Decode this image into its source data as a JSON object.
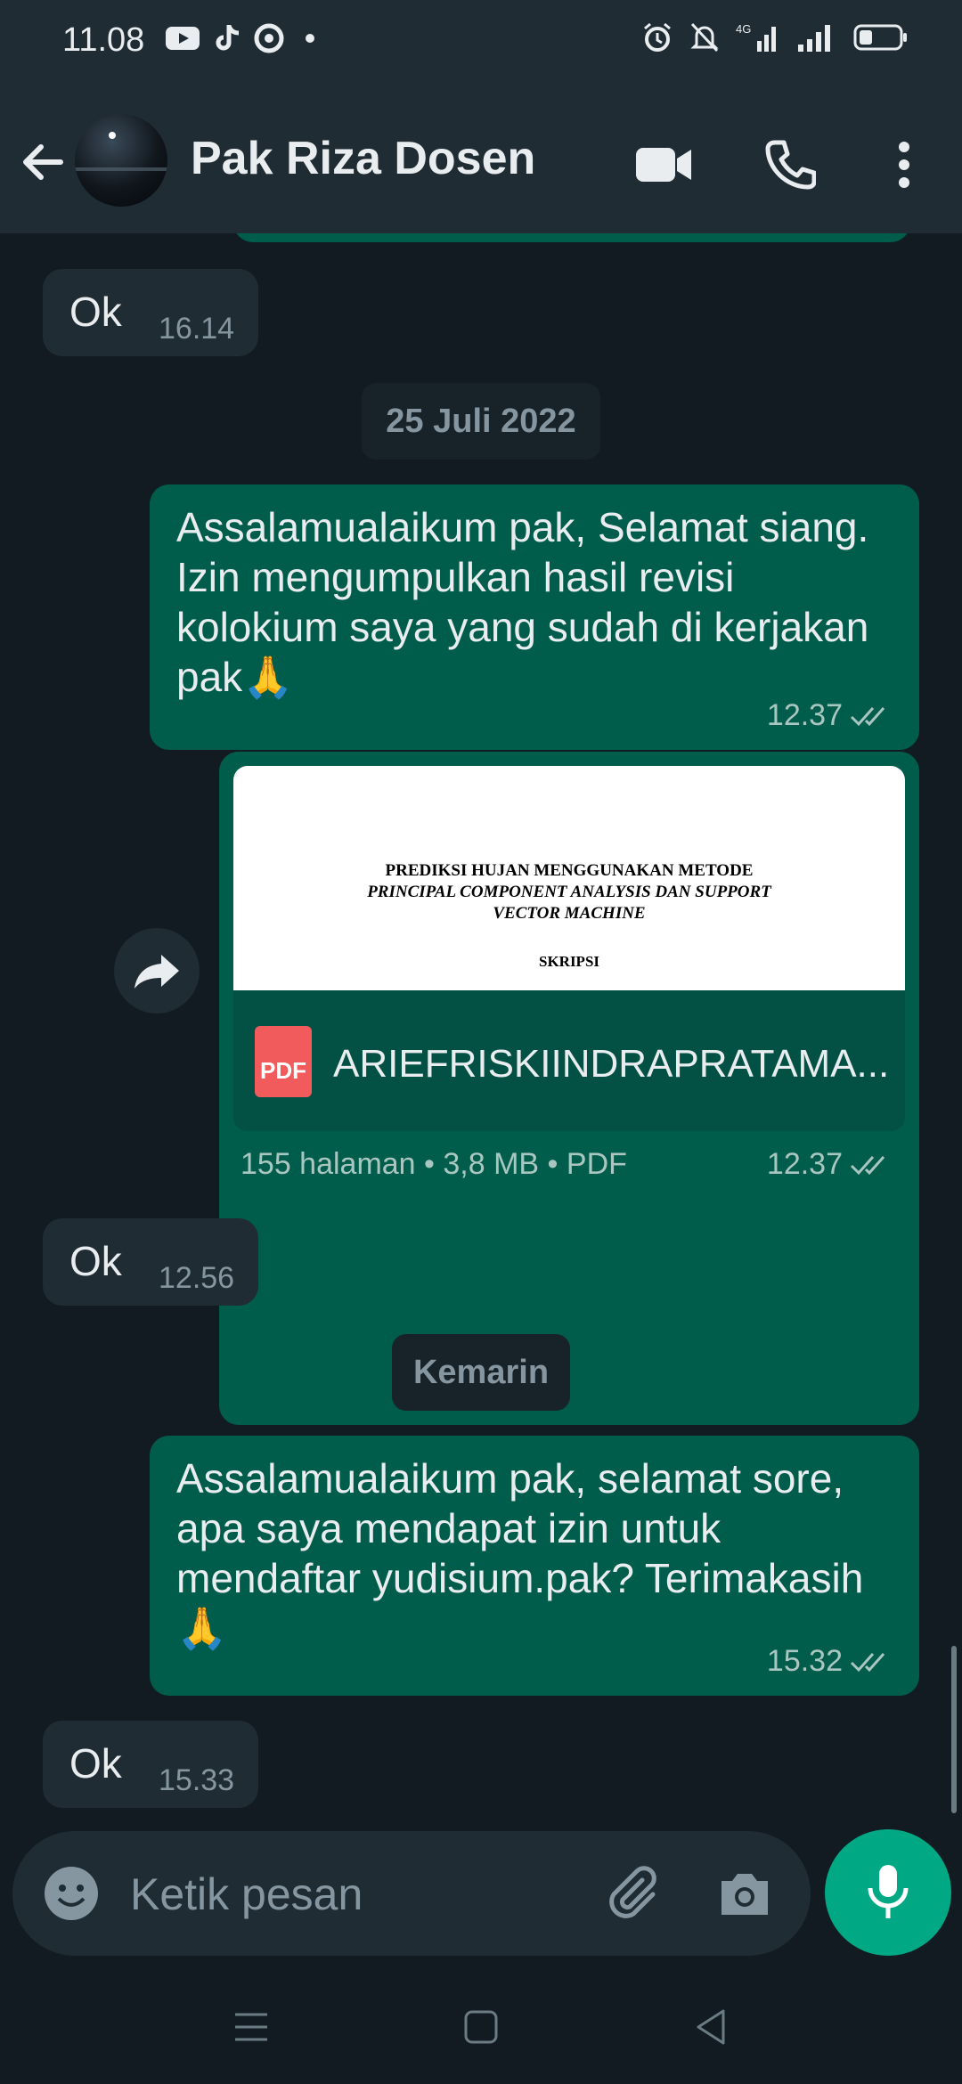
{
  "status_bar": {
    "time": "11.08",
    "network": "4G",
    "icons": [
      "youtube-icon",
      "tiktok-icon",
      "app-icon",
      "dot-icon",
      "alarm-icon",
      "mute-icon",
      "signal-icon",
      "wifi-signal-icon",
      "battery-icon"
    ]
  },
  "header": {
    "contact_name": "Pak Riza Dosen",
    "icons": [
      "back-arrow-icon",
      "video-call-icon",
      "phone-icon",
      "more-vert-icon"
    ]
  },
  "messages": {
    "m1": {
      "text": "Ok",
      "time": "16.14"
    },
    "date1": "25 Juli 2022",
    "m2": {
      "text": "Assalamualaikum pak, Selamat siang. Izin mengumpulkan hasil revisi kolokium saya yang sudah di kerjakan pak🙏",
      "time": "12.37"
    },
    "m3": {
      "preview_line1": "PREDIKSI HUJAN MENGGUNAKAN METODE",
      "preview_line2": "PRINCIPAL COMPONENT ANALYSIS DAN SUPPORT",
      "preview_line3": "VECTOR MACHINE",
      "preview_line4": "SKRIPSI",
      "pdf_badge": "PDF",
      "file_name": "ARIEFRISKIINDRAPRATAMA...",
      "meta": "155 halaman • 3,8 MB • PDF",
      "time": "12.37"
    },
    "m4": {
      "text": "Ok",
      "time": "12.56"
    },
    "date2": "Kemarin",
    "m5": {
      "text": "Assalamualaikum pak, selamat sore, apa saya mendapat izin untuk mendaftar yudisium.pak? Terimakasih🙏",
      "time": "15.32"
    },
    "m6": {
      "text": "Ok",
      "time": "15.33"
    }
  },
  "composer": {
    "placeholder": "Ketik pesan",
    "icons": [
      "emoji-icon",
      "attach-icon",
      "camera-icon",
      "mic-icon"
    ]
  },
  "colors": {
    "background": "#111b21",
    "incoming": "#202c33",
    "outgoing": "#005c4b",
    "accent": "#00a884"
  }
}
